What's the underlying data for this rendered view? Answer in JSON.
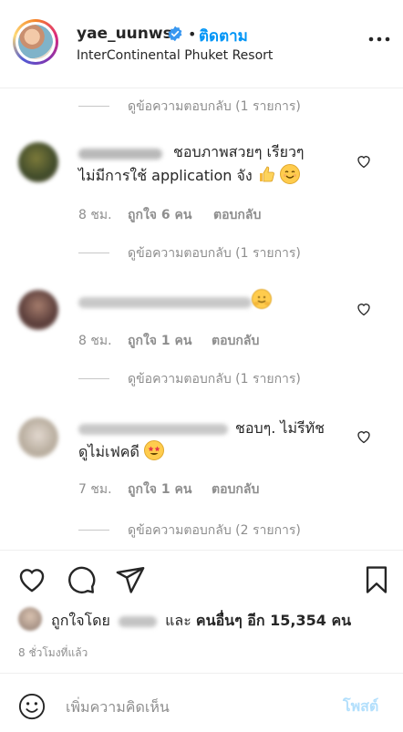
{
  "header": {
    "username": "yae_uunws",
    "dot": "•",
    "follow_label": "ติดตาม",
    "location": "InterContinental Phuket Resort"
  },
  "view_replies": [
    "ดูข้อความตอบกลับ (1 รายการ)",
    "ดูข้อความตอบกลับ (1 รายการ)",
    "ดูข้อความตอบกลับ (1 รายการ)",
    "ดูข้อความตอบกลับ (2 รายการ)"
  ],
  "comments": [
    {
      "line1": "ชอบภาพสวยๆ เรียวๆ",
      "line2": "ไม่มีการใช้ application จัง",
      "emoji": [
        "thumbs-up",
        "smiling-face"
      ],
      "time": "8 ชม.",
      "likes": "ถูกใจ 6 คน",
      "reply_label": "ตอบกลับ"
    },
    {
      "line1": "",
      "emoji": [
        "hugging-face"
      ],
      "time": "8 ชม.",
      "likes": "ถูกใจ 1 คน",
      "reply_label": "ตอบกลับ"
    },
    {
      "line1": "ชอบๆ. ไม่รีทัช",
      "line2": "ดูไม่เฟคดี",
      "emoji": [
        "star-struck"
      ],
      "time": "7 ชม.",
      "likes": "ถูกใจ 1 คน",
      "reply_label": "ตอบกลับ"
    }
  ],
  "likes": {
    "prefix": "ถูกใจโดย",
    "middle": "และ",
    "others": "คนอื่นๆ อีก 15,354 คน"
  },
  "time_ago": "8 ชั่วโมงที่แล้ว",
  "add_comment": {
    "placeholder": "เพิ่มความคิดเห็น",
    "post_label": "โพสต์"
  },
  "colors": {
    "link_blue": "#0095f6",
    "post_disabled": "#b2dffc",
    "secondary_text": "#8e8e8e"
  }
}
